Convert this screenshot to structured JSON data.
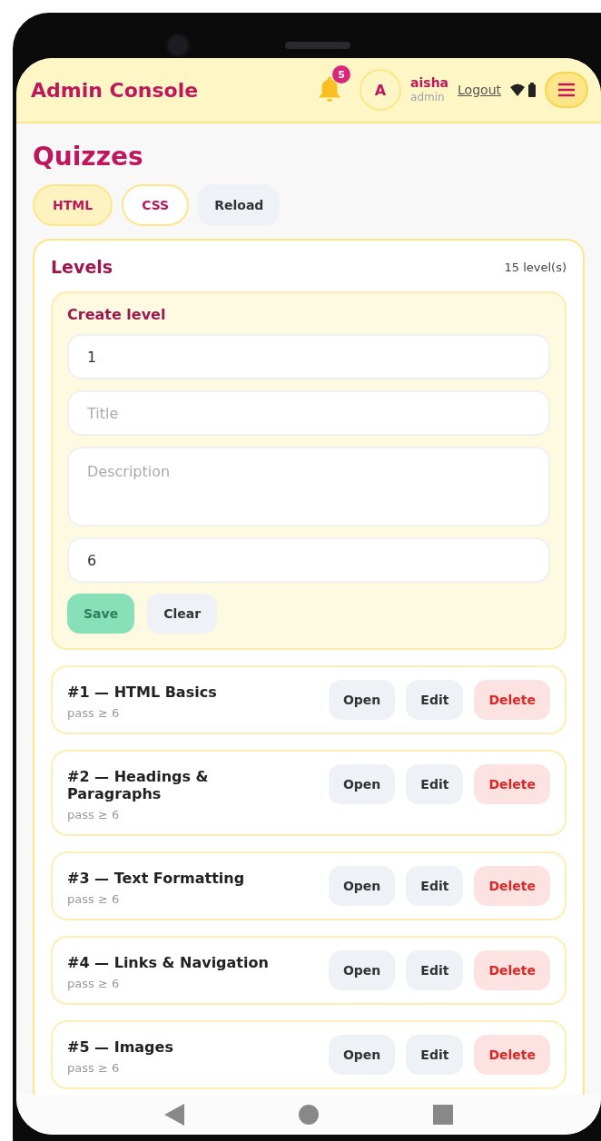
{
  "header": {
    "title": "Admin Console",
    "notifications": "5",
    "avatar": "A",
    "user": "aisha",
    "role": "admin",
    "logout": "Logout"
  },
  "page_title": "Quizzes",
  "tabs": [
    {
      "label": "HTML",
      "selected": true
    },
    {
      "label": "CSS",
      "selected": false
    }
  ],
  "reload": "Reload",
  "levels": {
    "title": "Levels",
    "count": "15 level(s)",
    "form": {
      "title": "Create level",
      "fields": [
        {
          "kind": "input",
          "value": "1"
        },
        {
          "kind": "input",
          "placeholder": "Title"
        },
        {
          "kind": "textarea",
          "placeholder": "Description"
        },
        {
          "kind": "input",
          "value": "6"
        }
      ],
      "save": "Save",
      "clear": "Clear"
    },
    "items": [
      {
        "title": "#1 — HTML Basics",
        "pass": "pass ≥ 6",
        "actions": [
          {
            "label": "Open",
            "kind": "plain"
          },
          {
            "label": "Edit",
            "kind": "plain"
          },
          {
            "label": "Delete",
            "kind": "danger"
          }
        ]
      },
      {
        "title": "#2 — Headings & Paragraphs",
        "pass": "pass ≥ 6",
        "actions": [
          {
            "label": "Open",
            "kind": "plain"
          },
          {
            "label": "Edit",
            "kind": "plain"
          },
          {
            "label": "Delete",
            "kind": "danger"
          }
        ]
      },
      {
        "title": "#3 — Text Formatting",
        "pass": "pass ≥ 6",
        "actions": [
          {
            "label": "Open",
            "kind": "plain"
          },
          {
            "label": "Edit",
            "kind": "plain"
          },
          {
            "label": "Delete",
            "kind": "danger"
          }
        ]
      },
      {
        "title": "#4 — Links & Navigation",
        "pass": "pass ≥ 6",
        "actions": [
          {
            "label": "Open",
            "kind": "plain"
          },
          {
            "label": "Edit",
            "kind": "plain"
          },
          {
            "label": "Delete",
            "kind": "danger"
          }
        ]
      },
      {
        "title": "#5 — Images",
        "pass": "pass ≥ 6",
        "actions": [
          {
            "label": "Open",
            "kind": "plain"
          },
          {
            "label": "Edit",
            "kind": "plain"
          },
          {
            "label": "Delete",
            "kind": "danger"
          }
        ]
      }
    ]
  }
}
